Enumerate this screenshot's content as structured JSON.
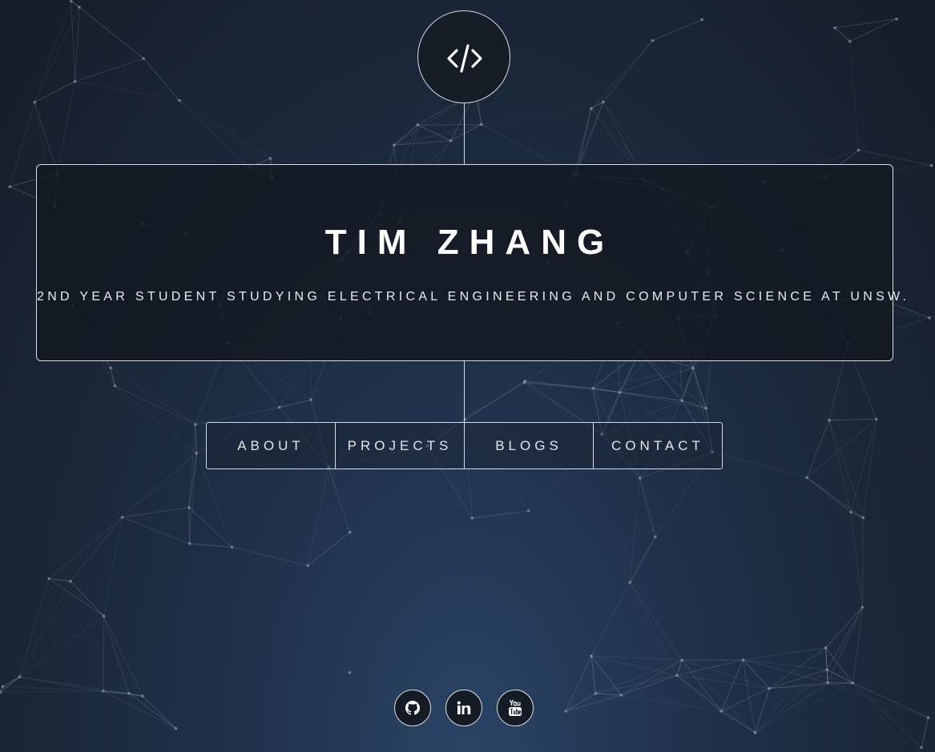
{
  "header": {
    "logo_icon": "code-icon"
  },
  "hero": {
    "name": "TIM ZHANG",
    "subtitle": "2ND YEAR STUDENT STUDYING ELECTRICAL ENGINEERING AND COMPUTER SCIENCE AT UNSW."
  },
  "nav": {
    "items": [
      {
        "label": "ABOUT"
      },
      {
        "label": "PROJECTS"
      },
      {
        "label": "BLOGS"
      },
      {
        "label": "CONTACT"
      }
    ]
  },
  "social": {
    "links": [
      {
        "icon": "github-icon"
      },
      {
        "icon": "linkedin-icon"
      },
      {
        "icon": "youtube-icon"
      }
    ]
  },
  "colors": {
    "background_top": "#151c27",
    "background_bottom": "#2a4365",
    "line": "#d8dbe0",
    "text": "#ffffff"
  }
}
